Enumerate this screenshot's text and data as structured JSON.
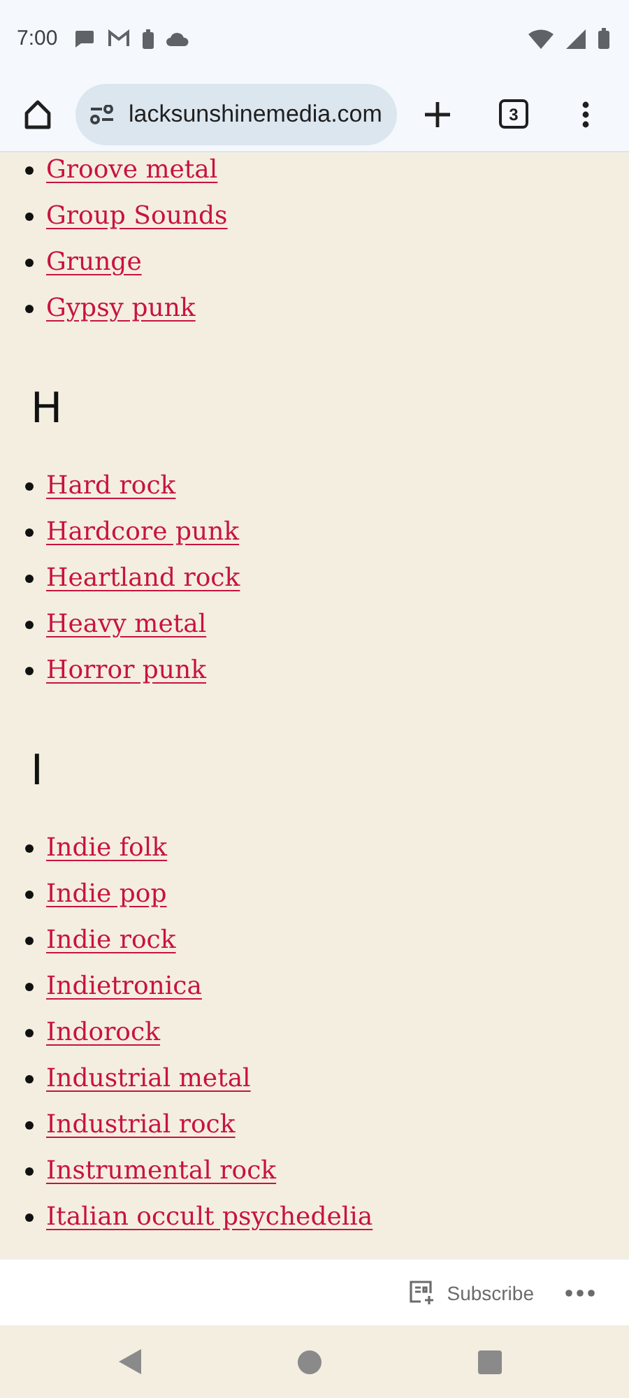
{
  "status_bar": {
    "time": "7:00"
  },
  "browser": {
    "url": "lacksunshinemedia.com",
    "tab_count": "3"
  },
  "sections": [
    {
      "items": [
        "Groove metal",
        "Group Sounds",
        "Grunge",
        "Gypsy punk"
      ]
    },
    {
      "heading": "H",
      "items": [
        "Hard rock",
        "Hardcore punk",
        "Heartland rock",
        "Heavy metal",
        "Horror punk"
      ]
    },
    {
      "heading": "I",
      "items": [
        "Indie folk",
        "Indie pop",
        "Indie rock",
        "Indietronica",
        "Indorock",
        "Industrial metal",
        "Industrial rock",
        "Instrumental rock",
        "Italian occult psychedelia"
      ]
    }
  ],
  "footer_bar": {
    "subscribe": "Subscribe"
  }
}
